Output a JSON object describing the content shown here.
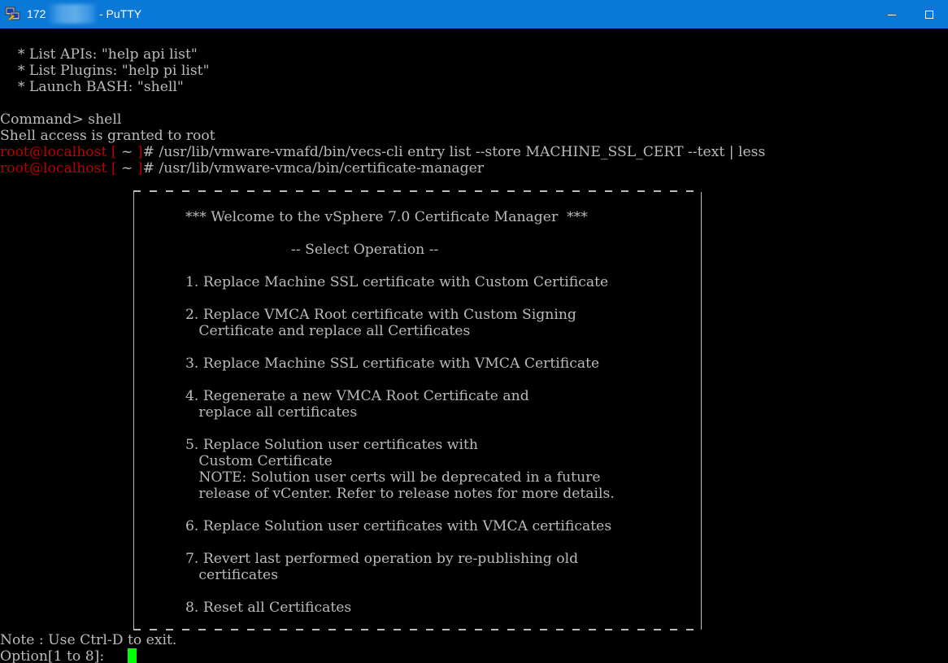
{
  "window": {
    "title_prefix": "172",
    "title_suffix": "- PuTTY",
    "icon": "putty-icon",
    "controls": [
      "minimize-icon",
      "maximize-icon"
    ]
  },
  "terminal": {
    "help_lines": [
      "    * List APIs: \"help api list\"",
      "    * List Plugins: \"help pi list\"",
      "    * Launch BASH: \"shell\""
    ],
    "command_prompt": "Command> shell",
    "shell_granted": "Shell access is granted to root",
    "prompt_user_host": "root@localhost",
    "prompt_bracket_open": " [ ",
    "prompt_dir": "~",
    "prompt_bracket_close": " ]",
    "prompt_hash": "# ",
    "command_1": "/usr/lib/vmware-vmafd/bin/vecs-cli entry list --store MACHINE_SSL_CERT --text | less",
    "command_2": "/usr/lib/vmware-vmca/bin/certificate-manager",
    "menu": {
      "welcome": "*** Welcome to the vSphere 7.0 Certificate Manager  ***",
      "select_operation": "-- Select Operation --",
      "options": [
        {
          "lines": [
            "1. Replace Machine SSL certificate with Custom Certificate"
          ]
        },
        {
          "lines": [
            "2. Replace VMCA Root certificate with Custom Signing",
            "   Certificate and replace all Certificates"
          ]
        },
        {
          "lines": [
            "3. Replace Machine SSL certificate with VMCA Certificate"
          ]
        },
        {
          "lines": [
            "4. Regenerate a new VMCA Root Certificate and",
            "   replace all certificates"
          ]
        },
        {
          "lines": [
            "5. Replace Solution user certificates with",
            "   Custom Certificate",
            "   NOTE: Solution user certs will be deprecated in a future",
            "   release of vCenter. Refer to release notes for more details."
          ]
        },
        {
          "lines": [
            "6. Replace Solution user certificates with VMCA certificates"
          ]
        },
        {
          "lines": [
            "7. Revert last performed operation by re-publishing old",
            "   certificates"
          ]
        },
        {
          "lines": [
            "8. Reset all Certificates"
          ]
        }
      ]
    },
    "note": "Note : Use Ctrl-D to exit.",
    "option_prompt": "Option[1 to 8]: ",
    "colors": {
      "background": "#000000",
      "text": "#bbbbbb",
      "prompt_red": "#bb0000",
      "cursor": "#00ff00",
      "titlebar": "#0a78d7"
    }
  }
}
